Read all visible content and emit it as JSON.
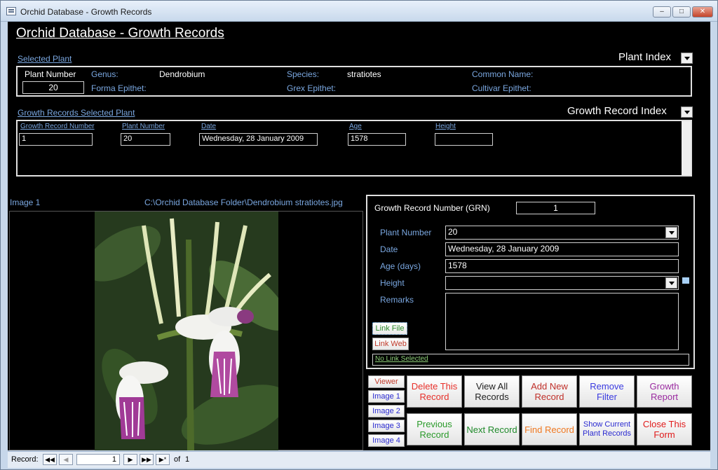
{
  "window": {
    "title": "Orchid Database - Growth Records"
  },
  "form_title": "Orchid Database - Growth Records",
  "selected_plant": {
    "section_label": "Selected Plant",
    "index_label": "Plant Index",
    "plant_number_label": "Plant Number",
    "plant_number": "20",
    "genus_label": "Genus:",
    "genus": "Dendrobium",
    "species_label": "Species:",
    "species": "stratiotes",
    "common_name_label": "Common Name:",
    "forma_label": "Forma Epithet:",
    "grex_label": "Grex Epithet:",
    "cultivar_label": "Cultivar Epithet:"
  },
  "growth_records": {
    "section_label": "Growth Records Selected Plant",
    "index_label": "Growth Record Index",
    "columns": [
      "Growth Record Number",
      "Plant Number",
      "Date",
      "Age",
      "Height"
    ],
    "row": {
      "grn": "1",
      "plant_number": "20",
      "date": "Wednesday, 28 January 2009",
      "age": "1578",
      "height": ""
    }
  },
  "image": {
    "label": "Image 1",
    "path": "C:\\Orchid Database Folder\\Dendrobium stratiotes.jpg"
  },
  "detail": {
    "grn_label": "Growth Record Number (GRN)",
    "grn": "1",
    "plant_number_label": "Plant Number",
    "plant_number": "20",
    "date_label": "Date",
    "date": "Wednesday, 28 January 2009",
    "age_label": "Age (days)",
    "age": "1578",
    "height_label": "Height",
    "height": "",
    "remarks_label": "Remarks",
    "remarks": "",
    "link_file": "Link File",
    "link_web": "Link Web",
    "link_status": "No Link Selected"
  },
  "image_buttons": [
    "Viewer",
    "Image 1",
    "Image 2",
    "Image 3",
    "Image 4"
  ],
  "actions": {
    "delete": "Delete This Record",
    "view_all": "View All Records",
    "add_new": "Add New Record",
    "remove_filter": "Remove Filter",
    "growth_report": "Growth Report",
    "previous": "Previous Record",
    "next": "Next Record",
    "find": "Find Record",
    "show_current": "Show Current Plant Records",
    "close": "Close This Form"
  },
  "colors": {
    "delete": "#e8302a",
    "view_all": "#222222",
    "add_new": "#c0302a",
    "remove_filter": "#3a3ae0",
    "growth_report": "#9a2aa0",
    "previous": "#2a9a2a",
    "next": "#1f8a2a",
    "find": "#f07820",
    "show_current": "#2a2ad0",
    "close": "#e01a1a"
  },
  "record_nav": {
    "label": "Record:",
    "current": "1",
    "of": "of",
    "total": "1"
  }
}
